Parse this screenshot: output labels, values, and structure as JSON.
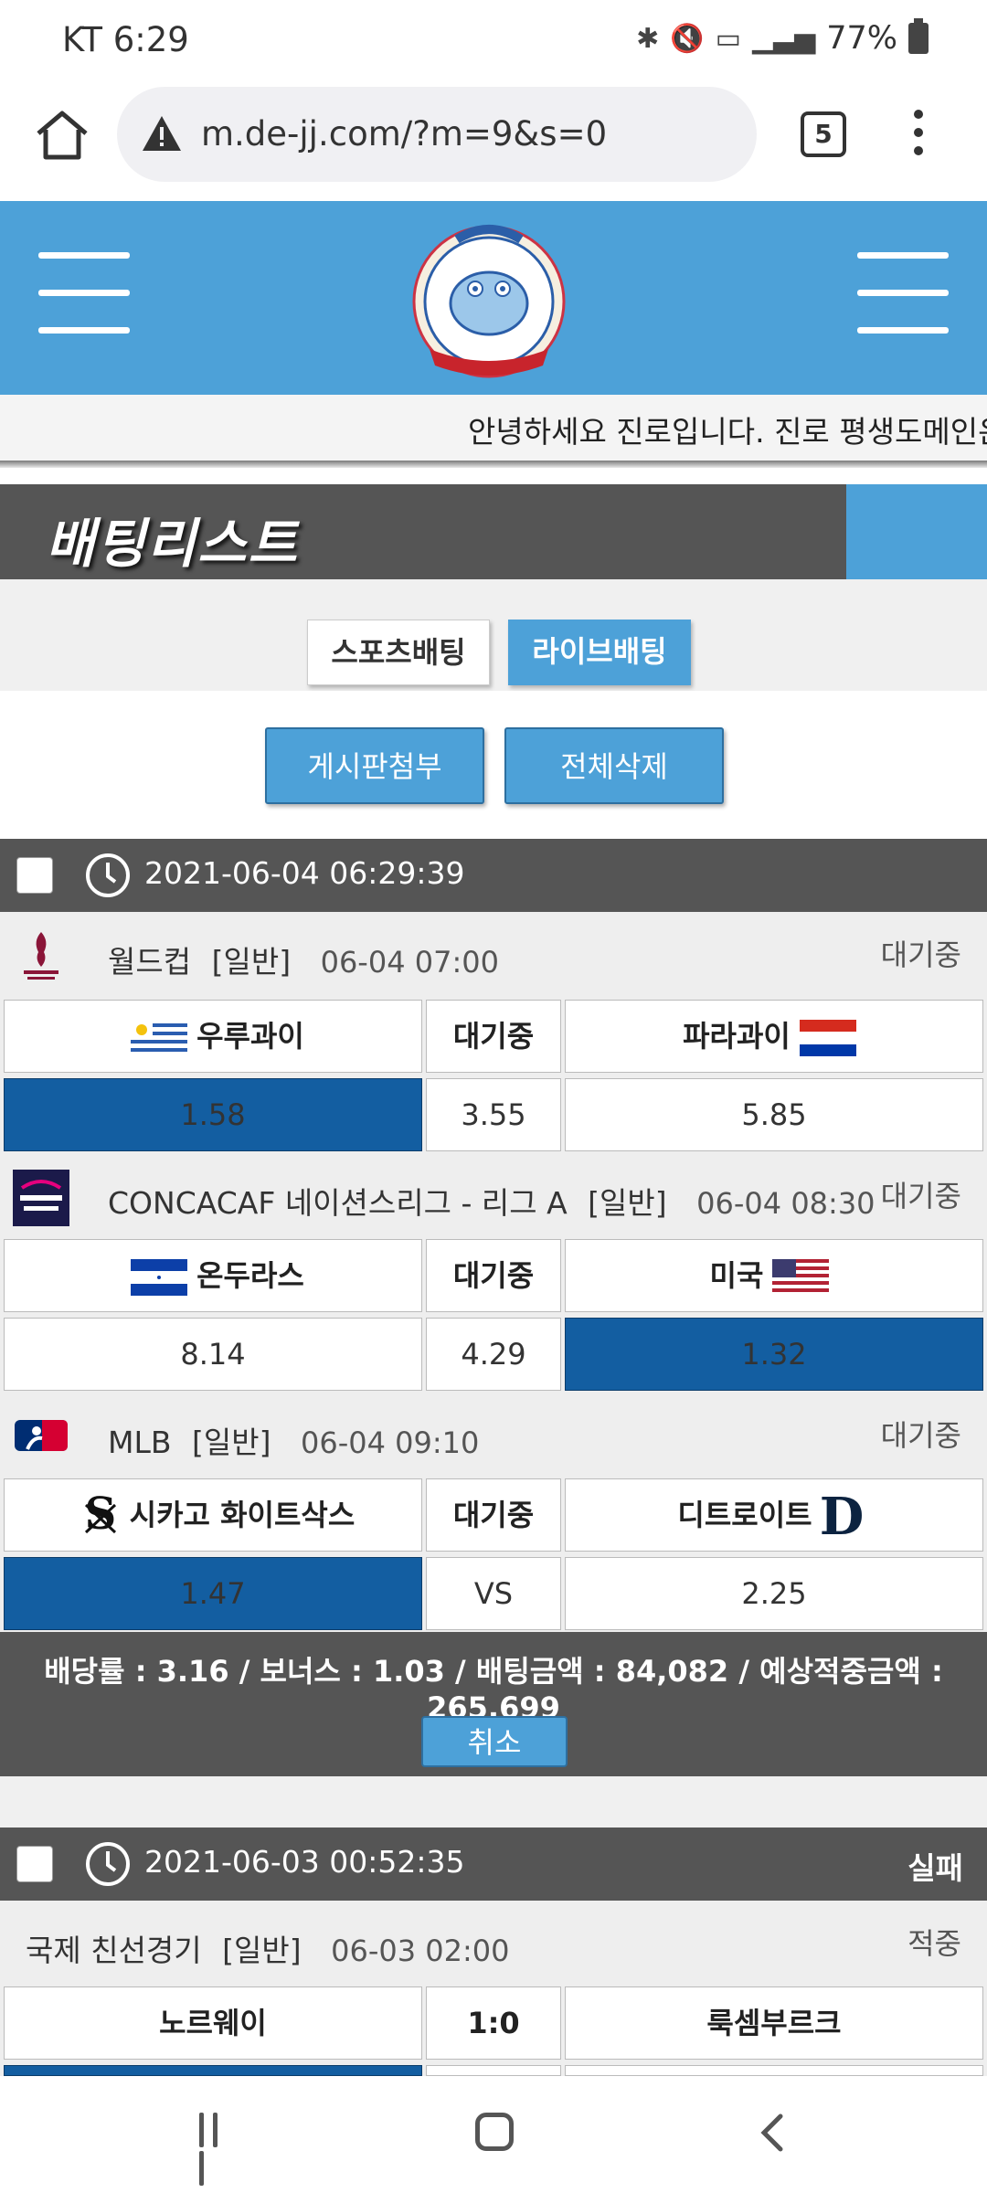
{
  "status_bar": {
    "carrier_time": "KT 6:29",
    "battery": "77%"
  },
  "browser": {
    "url": "m.de-jj.com/?m=9&s=0",
    "tab_count": "5"
  },
  "site": {
    "marquee": "안녕하세요 진로입니다. 진로 평생도메인은",
    "page_title": "배팅리스트",
    "tabs": [
      "스포츠배팅",
      "라이브배팅"
    ],
    "actions": {
      "attach": "게시판첨부",
      "delete_all": "전체삭제"
    }
  },
  "colors": {
    "accent": "#4da1d8",
    "dark_header": "#555555",
    "selected_odds": "#135ea1"
  },
  "bets": [
    {
      "time": "2021-06-04 06:29:39",
      "status": "",
      "matches": [
        {
          "league_icon": "world-cup-logo",
          "league": "월드컵",
          "type": "[일반]",
          "datetime": "06-04 07:00",
          "status": "대기중",
          "home": "우루과이",
          "middle": "대기중",
          "away": "파라과이",
          "odds_home": "1.58",
          "odds_mid": "3.55",
          "odds_away": "5.85",
          "selected": "home"
        },
        {
          "league_icon": "nations-league-logo",
          "league": "CONCACAF 네이션스리그 - 리그 A",
          "type": "[일반]",
          "datetime": "06-04 08:30",
          "status": "대기중",
          "home": "온두라스",
          "middle": "대기중",
          "away": "미국",
          "odds_home": "8.14",
          "odds_mid": "4.29",
          "odds_away": "1.32",
          "selected": "away"
        },
        {
          "league_icon": "mlb-logo",
          "league": "MLB",
          "type": "[일반]",
          "datetime": "06-04 09:10",
          "status": "대기중",
          "home": "시카고 화이트삭스",
          "middle": "대기중",
          "away": "디트로이트",
          "odds_home": "1.47",
          "odds_mid": "VS",
          "odds_away": "2.25",
          "selected": "home"
        }
      ],
      "summary": "배당률 : 3.16 / 보너스 : 1.03 / 배팅금액 : 84,082 / 예상적중금액 : 265,699",
      "cancel_label": "취소"
    },
    {
      "time": "2021-06-03 00:52:35",
      "status": "실패",
      "matches": [
        {
          "league": "국제 친선경기",
          "type": "[일반]",
          "datetime": "06-03 02:00",
          "status": "적중",
          "home": "노르웨이",
          "middle": "1:0",
          "away": "룩셈부르크"
        }
      ]
    }
  ]
}
